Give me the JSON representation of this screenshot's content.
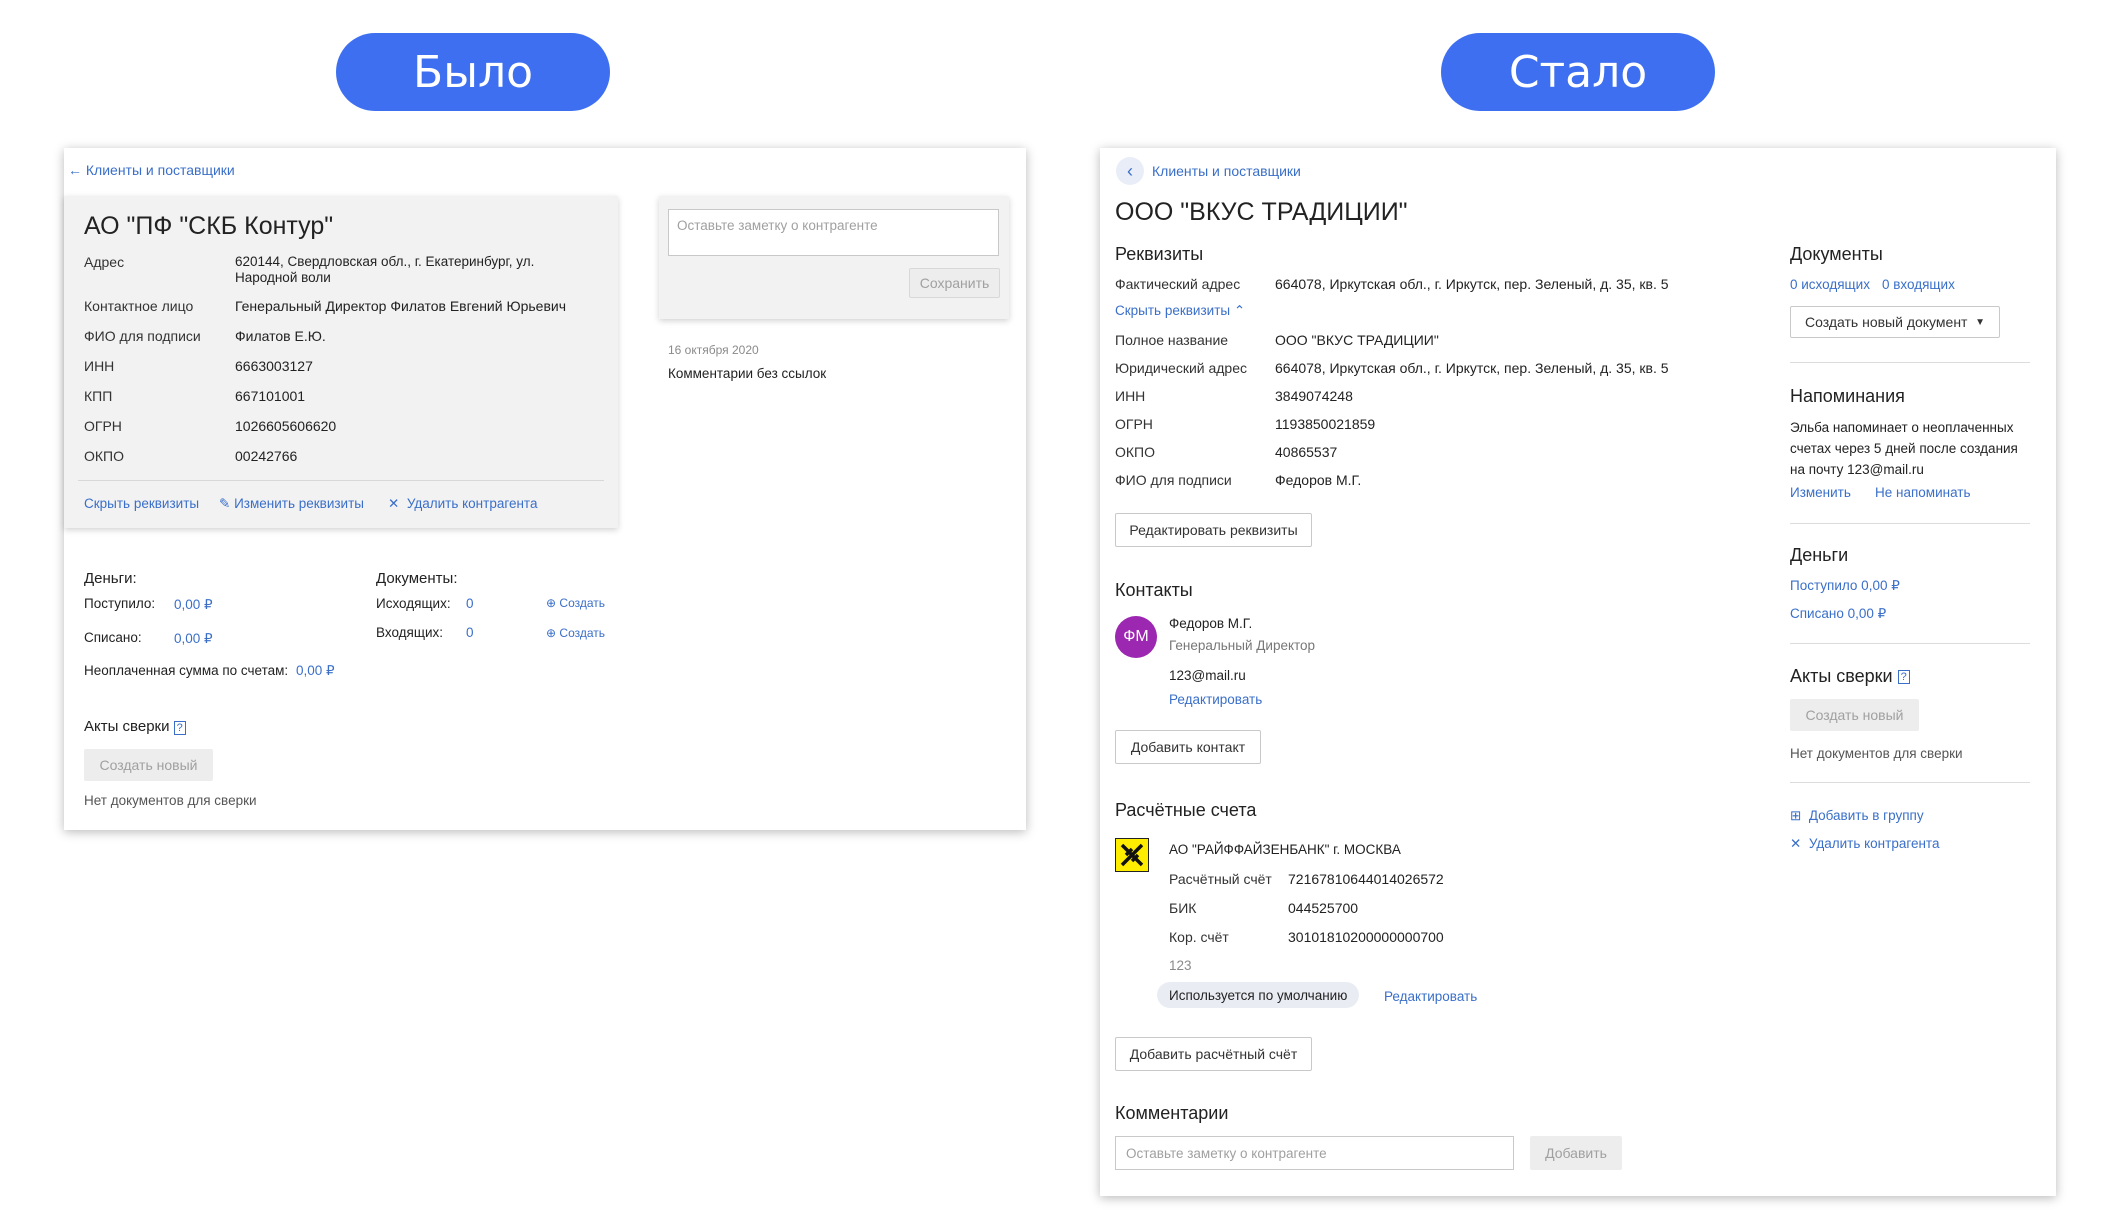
{
  "headers": {
    "before": "Было",
    "after": "Стало"
  },
  "before": {
    "back_link": "Клиенты и поставщики",
    "company_name": "АО \"ПФ \"СКБ Контур\"",
    "fields": [
      {
        "label": "Адрес",
        "value": "620144, Свердловская обл., г. Екатеринбург, ул. Народной воли"
      },
      {
        "label": "Контактное лицо",
        "value": "Генеральный Директор Филатов Евгений Юрьевич"
      },
      {
        "label": "ФИО для подписи",
        "value": "Филатов Е.Ю."
      },
      {
        "label": "ИНН",
        "value": "6663003127"
      },
      {
        "label": "КПП",
        "value": "667101001"
      },
      {
        "label": "ОГРН",
        "value": "1026605606620"
      },
      {
        "label": "ОКПО",
        "value": "00242766"
      }
    ],
    "actions": {
      "hide": "Скрыть реквизиты",
      "edit": "Изменить реквизиты",
      "delete": "Удалить контрагента"
    },
    "note_placeholder": "Оставьте заметку о контрагенте",
    "save_button": "Сохранить",
    "comment_date": "16 октября 2020",
    "comment_text": "Комментарии без ссылок",
    "money": {
      "title": "Деньги:",
      "received_label": "Поступило:",
      "received_value": "0,00 ₽",
      "written_label": "Списано:",
      "written_value": "0,00 ₽",
      "unpaid_label": "Неоплаченная сумма по счетам:",
      "unpaid_value": "0,00 ₽"
    },
    "documents": {
      "title": "Документы:",
      "outgoing_label": "Исходящих:",
      "outgoing_value": "0",
      "incoming_label": "Входящих:",
      "incoming_value": "0",
      "create": "Создать"
    },
    "reconciliation": {
      "title": "Акты сверки",
      "create_button": "Создать новый",
      "empty": "Нет документов для сверки"
    }
  },
  "after": {
    "back_link": "Клиенты и поставщики",
    "company_name": "ООО \"ВКУС ТРАДИЦИИ\"",
    "requisites": {
      "title": "Реквизиты",
      "actual_address_label": "Фактический адрес",
      "actual_address_value": "664078, Иркутская обл., г. Иркутск, пер. Зеленый, д. 35, кв. 5",
      "hide_link": "Скрыть реквизиты",
      "fields": [
        {
          "label": "Полное название",
          "value": "ООО \"ВКУС ТРАДИЦИИ\""
        },
        {
          "label": "Юридический адрес",
          "value": "664078, Иркутская обл., г. Иркутск, пер. Зеленый, д. 35, кв. 5"
        },
        {
          "label": "ИНН",
          "value": "3849074248"
        },
        {
          "label": "ОГРН",
          "value": "1193850021859"
        },
        {
          "label": "ОКПО",
          "value": "40865537"
        },
        {
          "label": "ФИО для подписи",
          "value": "Федоров М.Г."
        }
      ],
      "edit_button": "Редактировать реквизиты"
    },
    "contacts": {
      "title": "Контакты",
      "avatar_initials": "ФМ",
      "name": "Федоров М.Г.",
      "position": "Генеральный Директор",
      "email": "123@mail.ru",
      "edit_link": "Редактировать",
      "add_button": "Добавить контакт"
    },
    "accounts": {
      "title": "Расчётные счета",
      "bank_name": "АО \"РАЙФФАЙЗЕНБАНК\" г. МОСКВА",
      "rows": [
        {
          "label": "Расчётный счёт",
          "value": "72167810644014026572"
        },
        {
          "label": "БИК",
          "value": "044525700"
        },
        {
          "label": "Кор. счёт",
          "value": "30101810200000000700"
        }
      ],
      "note": "123",
      "default_badge": "Используется по умолчанию",
      "edit_link": "Редактировать",
      "add_button": "Добавить расчётный счёт"
    },
    "comments": {
      "title": "Комментарии",
      "placeholder": "Оставьте заметку о контрагенте",
      "add_button": "Добавить"
    },
    "side": {
      "documents_title": "Документы",
      "outgoing": "0 исходящих",
      "incoming": "0 входящих",
      "create_doc_button": "Создать новый документ",
      "reminders_title": "Напоминания",
      "reminders_text_1": "Эльба напоминает о неоплаченных",
      "reminders_text_2": "счетах через 5 дней после создания",
      "reminders_text_3": "на почту 123@mail.ru",
      "reminders_change": "Изменить",
      "reminders_off": "Не напоминать",
      "money_title": "Деньги",
      "received": "Поступило 0,00 ₽",
      "written": "Списано 0,00 ₽",
      "reconciliation_title": "Акты сверки",
      "reconciliation_create": "Создать новый",
      "reconciliation_empty": "Нет документов для сверки",
      "add_to_group": "Добавить в группу",
      "delete_contractor": "Удалить контрагента"
    },
    "colors": {
      "accent": "#3d6ff0",
      "link": "#3a6fc9",
      "avatar": "#9c27b0",
      "bank_logo": "#ffed00"
    }
  }
}
